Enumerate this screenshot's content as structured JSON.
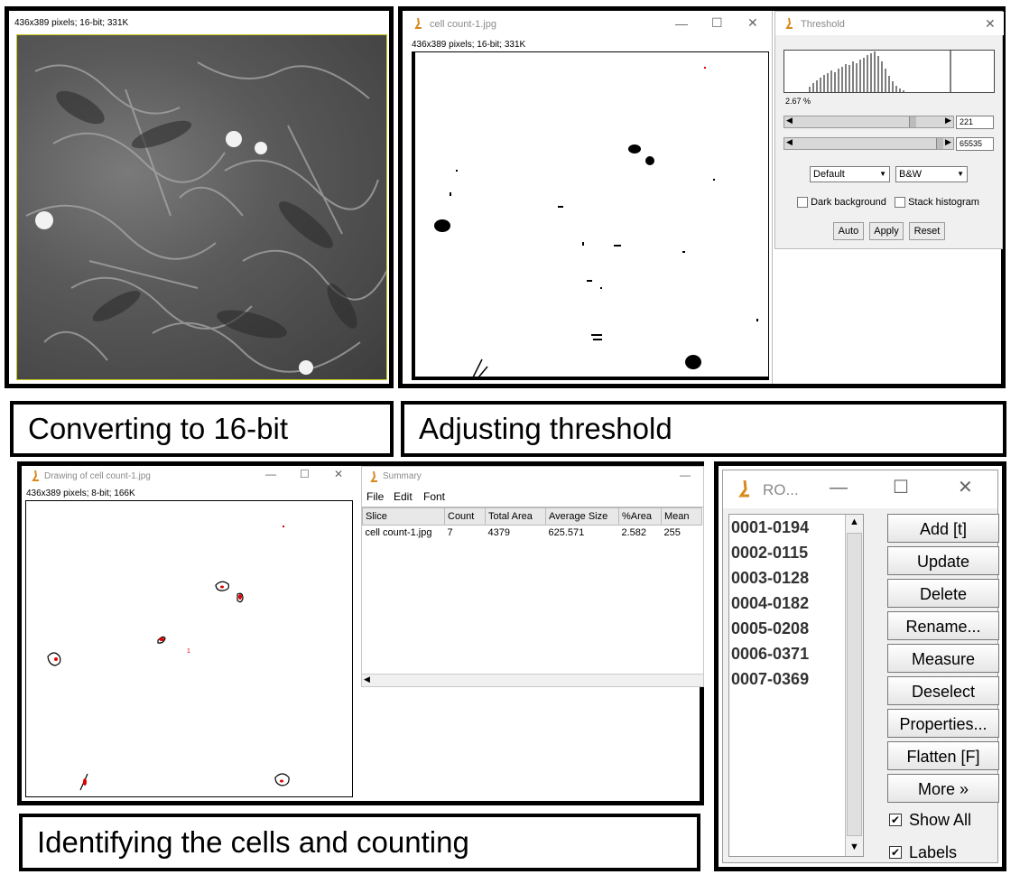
{
  "panel1": {
    "info": "436x389 pixels; 16-bit; 331K",
    "caption": "Converting to 16-bit"
  },
  "panel2": {
    "window_title": "cell count-1.jpg",
    "info": "436x389 pixels; 16-bit; 331K",
    "caption": "Adjusting threshold"
  },
  "threshold": {
    "title": "Threshold",
    "percent": "2.67 %",
    "min_value": "221",
    "max_value": "65535",
    "method": "Default",
    "display_mode": "B&W",
    "dark_background_label": "Dark background",
    "stack_histogram_label": "Stack histogram",
    "auto_label": "Auto",
    "apply_label": "Apply",
    "reset_label": "Reset"
  },
  "drawing": {
    "window_title": "Drawing of cell count-1.jpg",
    "info": "436x389 pixels; 8-bit; 166K",
    "caption": "Identifying the cells and counting",
    "labels": [
      "1"
    ]
  },
  "summary": {
    "title": "Summary",
    "menu": [
      "File",
      "Edit",
      "Font"
    ],
    "columns": [
      "Slice",
      "Count",
      "Total Area",
      "Average Size",
      "%Area",
      "Mean"
    ],
    "rows": [
      [
        "cell count-1.jpg",
        "7",
        "4379",
        "625.571",
        "2.582",
        "255"
      ]
    ]
  },
  "roi": {
    "title": "RO...",
    "items": [
      "0001-0194",
      "0002-0115",
      "0003-0128",
      "0004-0182",
      "0005-0208",
      "0006-0371",
      "0007-0369"
    ],
    "buttons": [
      "Add [t]",
      "Update",
      "Delete",
      "Rename...",
      "Measure",
      "Deselect",
      "Properties...",
      "Flatten [F]",
      "More »"
    ],
    "show_all_label": "Show All",
    "labels_label": "Labels"
  },
  "colors": {
    "frame": "#000000",
    "accent_red": "#e00000",
    "icon_orange": "#d98a1c"
  }
}
